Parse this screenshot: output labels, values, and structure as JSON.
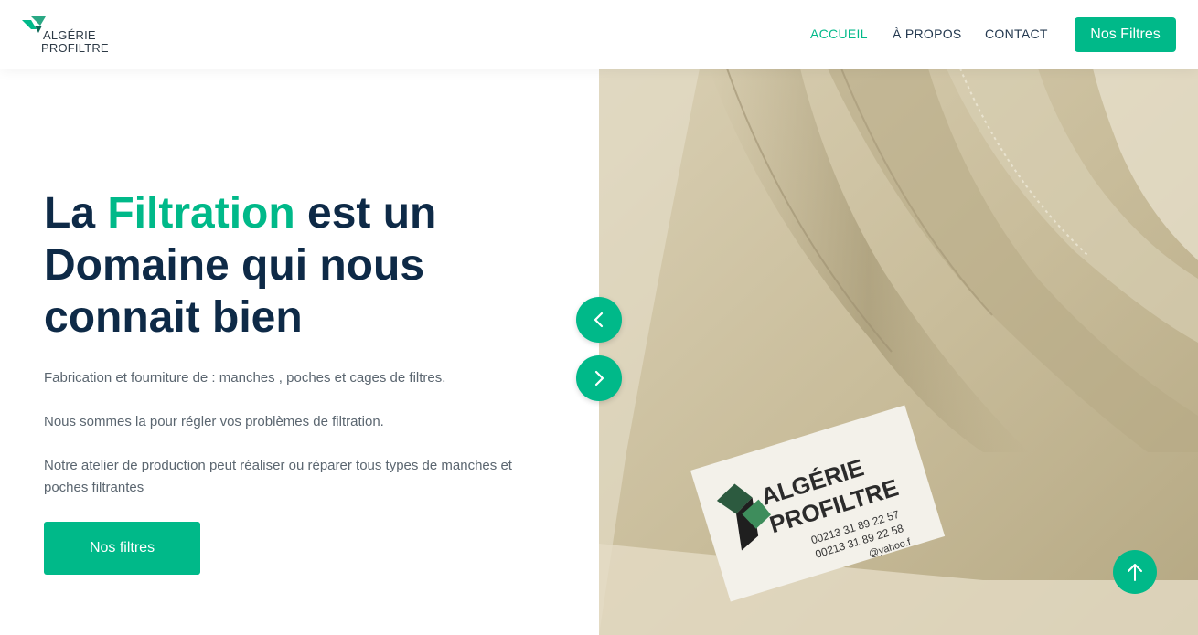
{
  "brand": {
    "line1": "ALGÉRIE",
    "line2": "PROFILTRE"
  },
  "nav": {
    "items": [
      {
        "label": "ACCUEIL",
        "active": true
      },
      {
        "label": "À PROPOS",
        "active": false
      },
      {
        "label": "CONTACT",
        "active": false
      }
    ],
    "cta_label": "Nos Filtres"
  },
  "hero": {
    "title_before": "La ",
    "title_accent": "Filtration",
    "title_after": " est un Domaine qui nous connait bien",
    "paragraphs": [
      "Fabrication et fourniture de : manches , poches et cages de filtres.",
      "Nous sommes la pour régler vos problèmes de filtration.",
      "Notre atelier de production peut réaliser ou réparer tous types de manches et poches filtrantes"
    ],
    "cta_label": "Nos filtres"
  },
  "slider": {
    "prev_icon": "chevron-left-icon",
    "next_icon": "chevron-right-icon"
  },
  "photo_label": {
    "line1": "ALGÉRIE",
    "line2": "PROFILTRE",
    "phone1": "00213 31 89 22 57",
    "phone2": "00213 31 89 22 58",
    "email_fragment": "@yahoo.f"
  },
  "scroll_top_icon": "arrow-up-icon",
  "colors": {
    "accent": "#00b989",
    "heading": "#0e2a47",
    "body_text": "#5b6670"
  }
}
